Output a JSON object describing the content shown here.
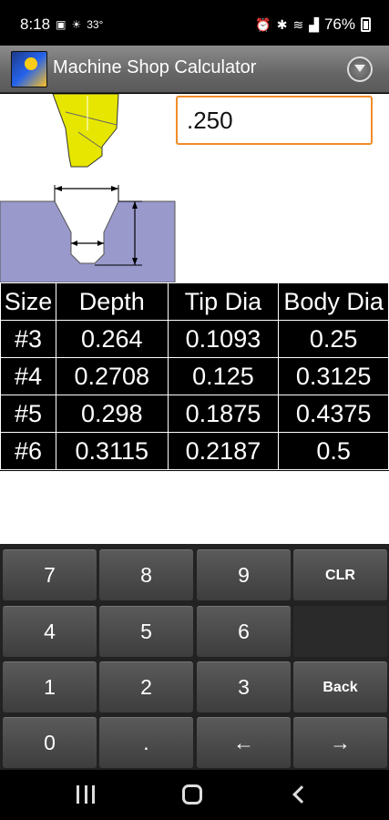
{
  "status_bar": {
    "time": "8:18",
    "temp": "33°",
    "battery": "76%"
  },
  "app": {
    "title": "Machine Shop Calculator"
  },
  "input": {
    "value": ".250"
  },
  "table": {
    "headers": [
      "Size",
      "Depth",
      "Tip Dia",
      "Body Dia"
    ],
    "rows": [
      [
        "#3",
        "0.264",
        "0.1093",
        "0.25"
      ],
      [
        "#4",
        "0.2708",
        "0.125",
        "0.3125"
      ],
      [
        "#5",
        "0.298",
        "0.1875",
        "0.4375"
      ],
      [
        "#6",
        "0.3115",
        "0.2187",
        "0.5"
      ]
    ]
  },
  "keypad": {
    "keys": [
      "7",
      "8",
      "9",
      "CLR",
      "4",
      "5",
      "6",
      "",
      "1",
      "2",
      "3",
      "Back",
      "0",
      ".",
      "←",
      "→"
    ]
  },
  "colors": {
    "drill": "#e6e600",
    "workpiece": "#9999cc",
    "input_border": "#f28c28"
  }
}
